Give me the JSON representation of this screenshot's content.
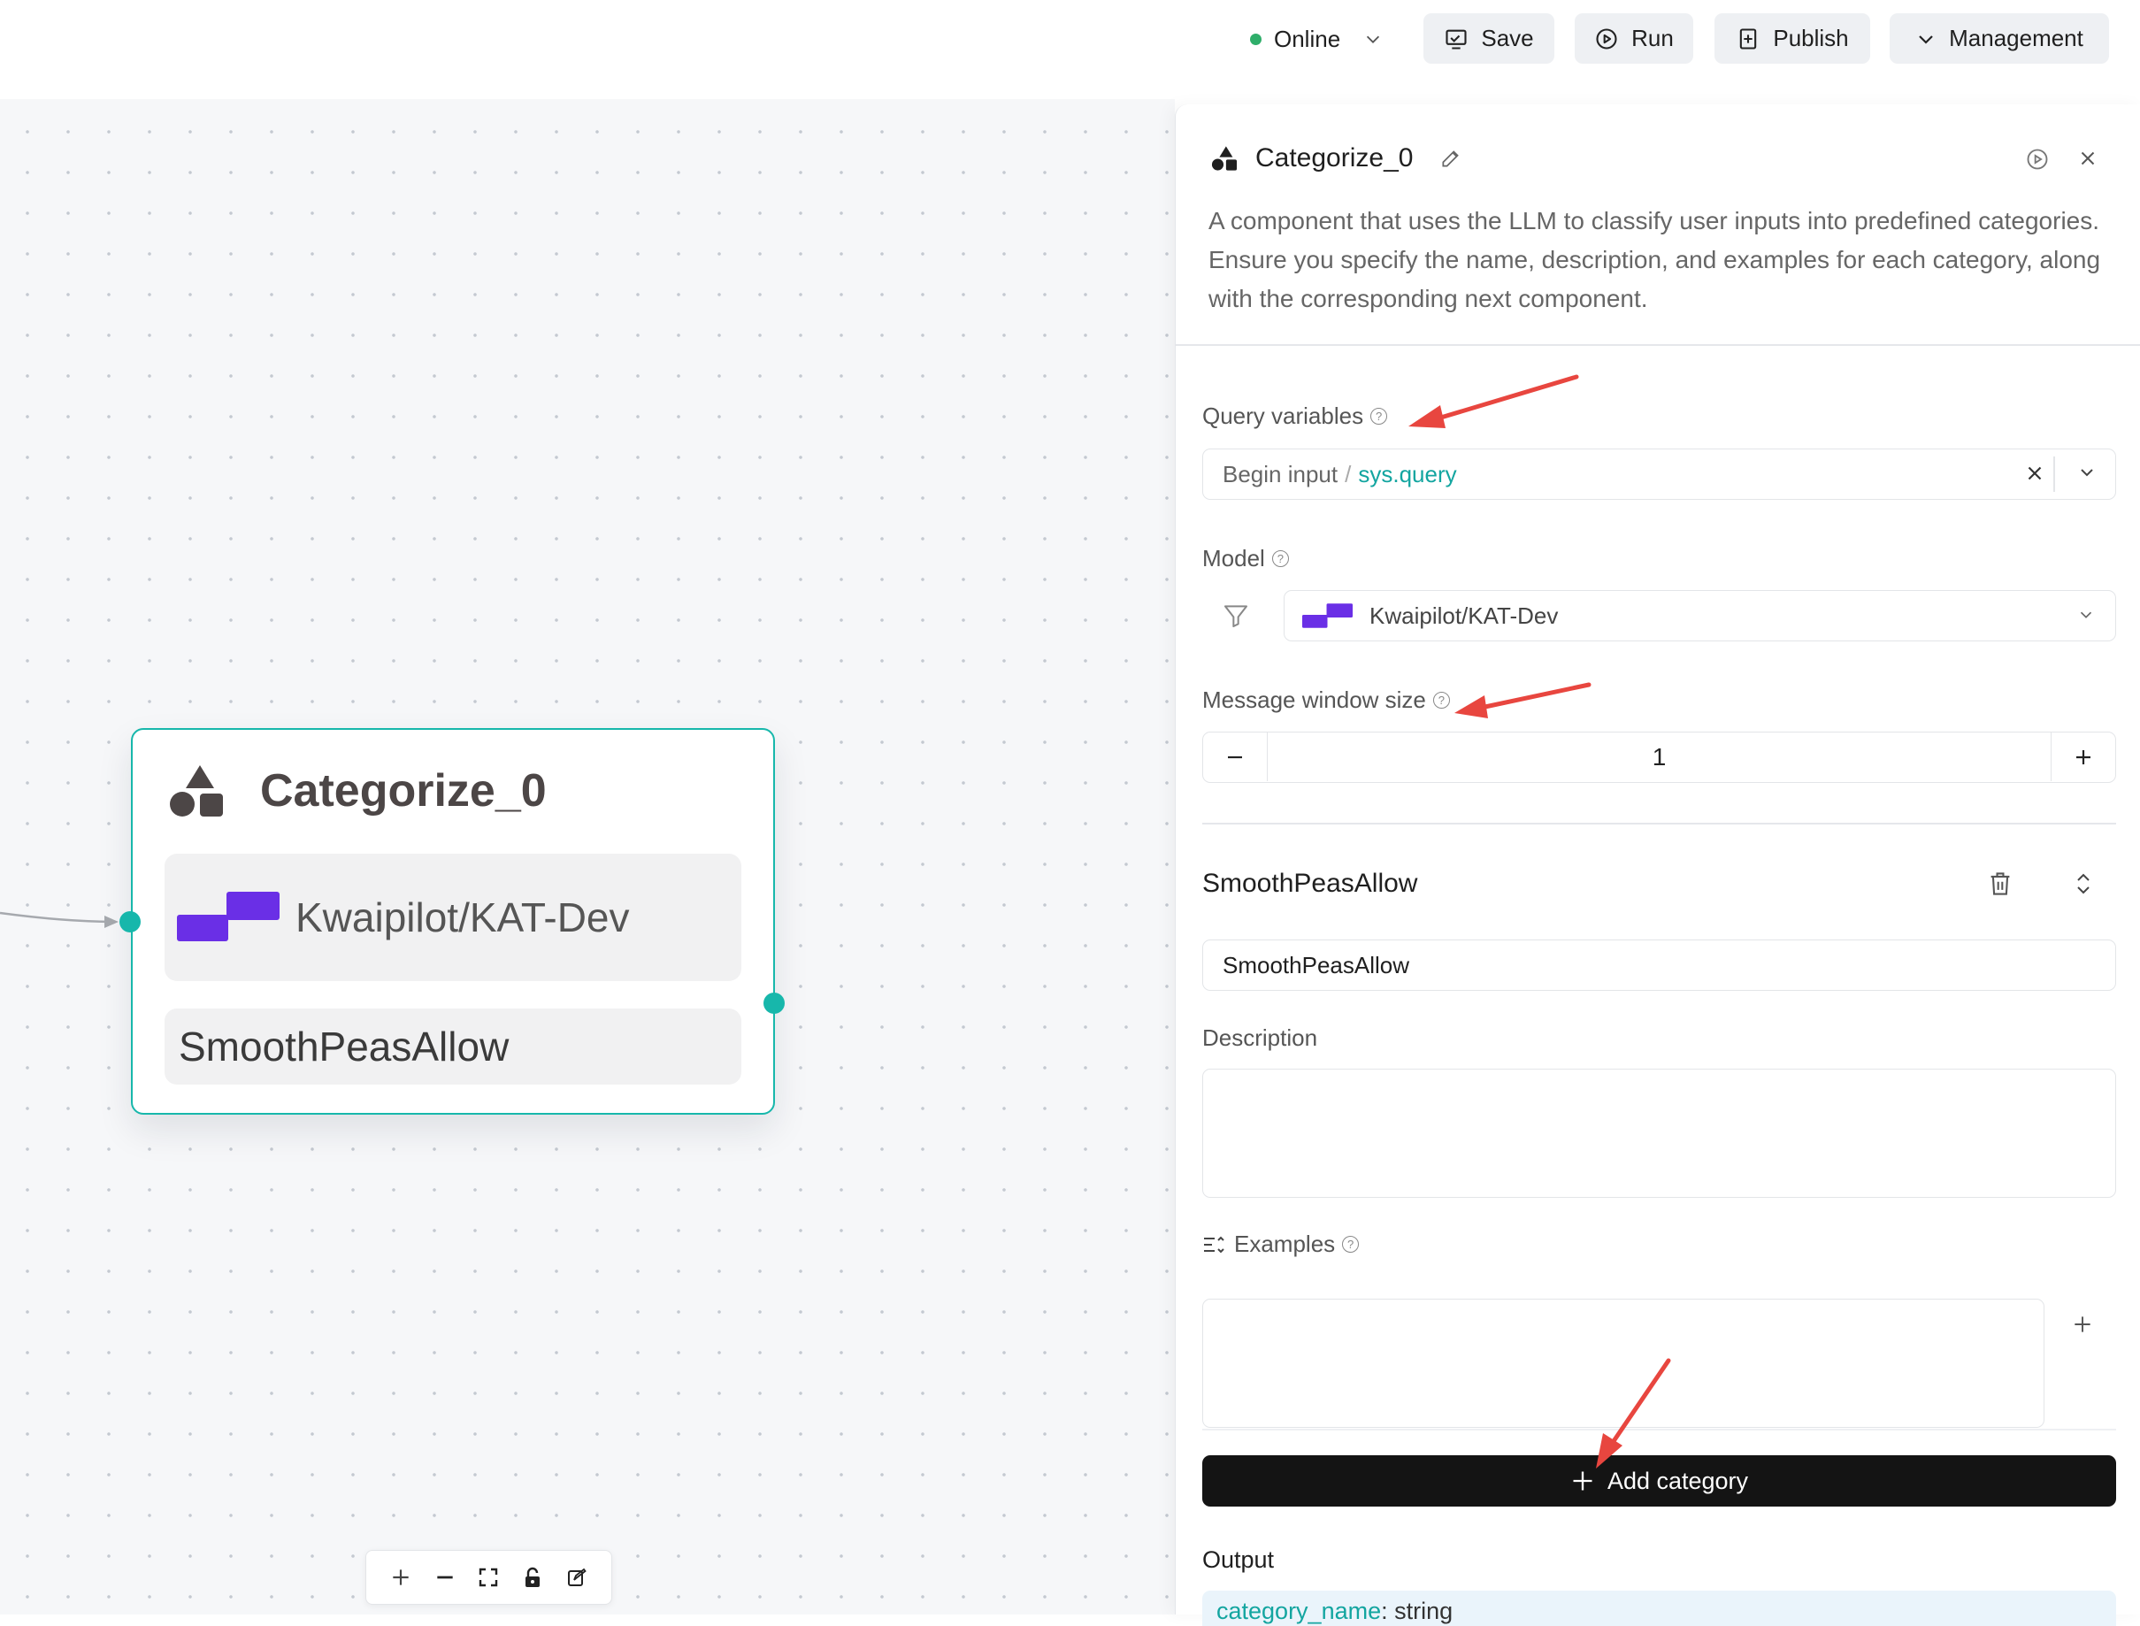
{
  "topbar": {
    "status_label": "Online",
    "status_color": "#2fae6a",
    "save_label": "Save",
    "run_label": "Run",
    "publish_label": "Publish",
    "management_label": "Management"
  },
  "canvas": {
    "node": {
      "title": "Categorize_0",
      "model_name": "Kwaipilot/KAT-Dev",
      "category_name": "SmoothPeasAllow",
      "accent_color": "#17b7ab"
    },
    "zoom_controls": [
      "plus-icon",
      "minus-icon",
      "fit-view-icon",
      "lock-icon",
      "note-icon"
    ]
  },
  "panel": {
    "title": "Categorize_0",
    "description": "A component that uses the LLM to classify user inputs into predefined categories. Ensure you specify the name, description, and examples for each category, along with the corresponding next component.",
    "query_variables": {
      "label": "Query variables",
      "source": "Begin input",
      "separator": "/",
      "variable": "sys.query"
    },
    "model": {
      "label": "Model",
      "selected": "Kwaipilot/KAT-Dev"
    },
    "message_window": {
      "label": "Message window size",
      "value": "1"
    },
    "category": {
      "title": "SmoothPeasAllow",
      "name_value": "SmoothPeasAllow",
      "description_label": "Description",
      "description_value": "",
      "examples_label": "Examples",
      "examples_value": ""
    },
    "add_category_label": "Add category",
    "output": {
      "label": "Output",
      "key": "category_name",
      "type": ": string"
    }
  },
  "colors": {
    "annotation_arrow": "#e8463f",
    "model_logo": "#6a2fe6",
    "variable_text": "#13a5a0"
  }
}
